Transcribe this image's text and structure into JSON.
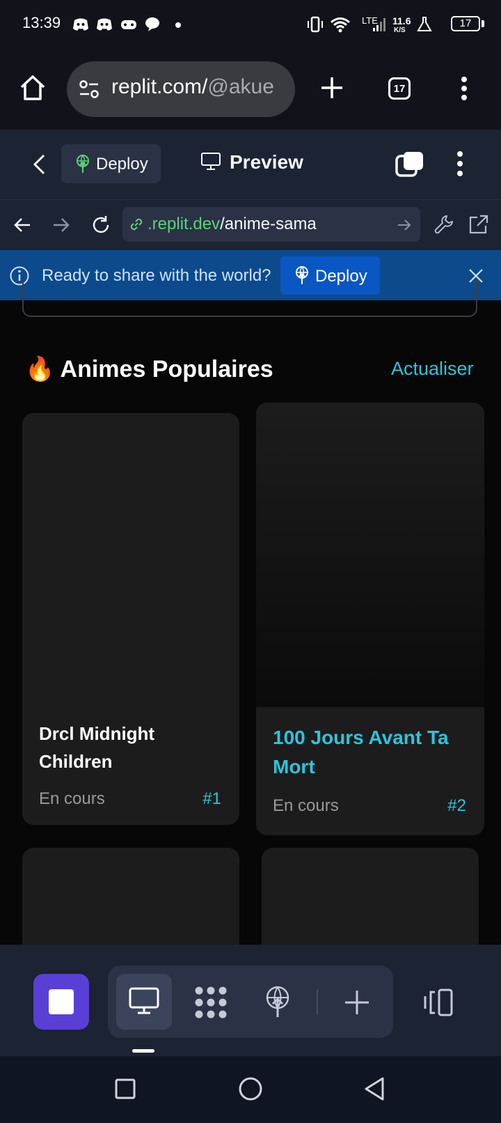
{
  "status_bar": {
    "time": "13:39",
    "network": "LTE",
    "speed_value": "11.6",
    "speed_unit": "K/S",
    "battery": "17"
  },
  "browser": {
    "url_host": "replit.com/",
    "url_path": "@akue",
    "tab_count": "17"
  },
  "replit_header": {
    "deploy_label": "Deploy",
    "preview_label": "Preview"
  },
  "address_bar": {
    "domain": ".replit.dev",
    "path": "/anime-sama"
  },
  "banner": {
    "message": "Ready to share with the world?",
    "deploy_label": "Deploy"
  },
  "section": {
    "title": "Animes Populaires",
    "emoji": "🔥",
    "refresh_label": "Actualiser"
  },
  "cards": [
    {
      "title_line1": "Drcl Midnight",
      "title_line2": "Children",
      "status": "En cours",
      "rank": "#1"
    },
    {
      "title_line1": "100 Jours Avant Ta",
      "title_line2": "Mort",
      "status": "En cours",
      "rank": "#2"
    }
  ],
  "colors": {
    "accent": "#2fc4db",
    "replit_bg": "#1c2333",
    "banner_bg": "#0c4a8c",
    "stop_button": "#5a3fd6"
  }
}
